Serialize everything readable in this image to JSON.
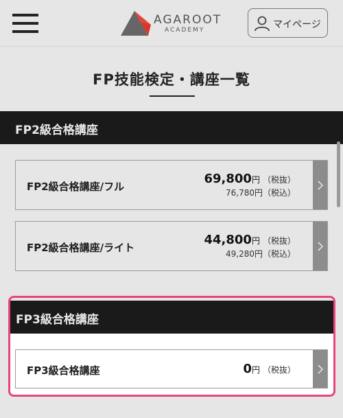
{
  "header": {
    "logo_main": "AGAROOT",
    "logo_sub": "ACADEMY",
    "mypage_label": "マイページ"
  },
  "page_title": "FP技能検定・講座一覧",
  "sections": [
    {
      "title": "FP2級合格講座",
      "courses": [
        {
          "name": "FP2級合格講座/フル",
          "price": "69,800",
          "yen": "円",
          "tax_note": "（税抜）",
          "price_incl": "76,780円（税込）"
        },
        {
          "name": "FP2級合格講座/ライト",
          "price": "44,800",
          "yen": "円",
          "tax_note": "（税抜）",
          "price_incl": "49,280円（税込）"
        }
      ]
    },
    {
      "title": "FP3級合格講座",
      "courses": [
        {
          "name": "FP3級合格講座",
          "price": "0",
          "yen": "円",
          "tax_note": "（税抜）"
        }
      ]
    }
  ],
  "colors": {
    "accent_pink": "#e8457a",
    "logo_red": "#d9352b",
    "section_bg": "#1a1a1a"
  },
  "icons": {
    "menu": "hamburger-icon",
    "user": "user-icon",
    "arrow": "chevron-right-icon"
  }
}
